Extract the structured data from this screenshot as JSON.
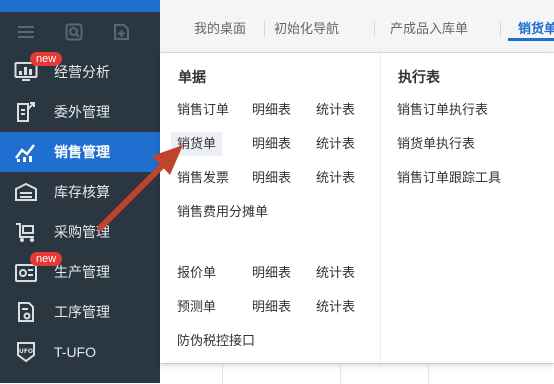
{
  "sidebar": {
    "items": [
      {
        "label": "经营分析",
        "icon": "monitor-chart-icon",
        "badge": "new",
        "active": false
      },
      {
        "label": "委外管理",
        "icon": "clipboard-share-icon",
        "badge": "",
        "active": false
      },
      {
        "label": "销售管理",
        "icon": "line-chart-icon",
        "badge": "",
        "active": true
      },
      {
        "label": "库存核算",
        "icon": "warehouse-icon",
        "badge": "",
        "active": false
      },
      {
        "label": "采购管理",
        "icon": "cart-icon",
        "badge": "",
        "active": false
      },
      {
        "label": "生产管理",
        "icon": "gears-icon",
        "badge": "new",
        "active": false
      },
      {
        "label": "工序管理",
        "icon": "document-gear-icon",
        "badge": "",
        "active": false
      },
      {
        "label": "T-UFO",
        "icon": "ufo-icon",
        "badge": "",
        "active": false
      }
    ]
  },
  "tabs": [
    {
      "label": "我的桌面",
      "active": false
    },
    {
      "label": "初始化导航",
      "active": false
    },
    {
      "label": "产成品入库单",
      "active": false
    },
    {
      "label": "销货单",
      "active": true
    }
  ],
  "menu": {
    "sections": {
      "documents": {
        "title": "单据"
      },
      "reports": {
        "title": "执行表"
      }
    },
    "rows": [
      {
        "name": "销售订单",
        "detail": "明细表",
        "stats": "统计表"
      },
      {
        "name": "销货单",
        "detail": "明细表",
        "stats": "统计表"
      },
      {
        "name": "销售发票",
        "detail": "明细表",
        "stats": "统计表"
      },
      {
        "name": "销售费用分摊单"
      },
      {
        "name": "报价单",
        "detail": "明细表",
        "stats": "统计表"
      },
      {
        "name": "预测单",
        "detail": "明细表",
        "stats": "统计表"
      },
      {
        "name": "防伪税控接口"
      }
    ],
    "report_items": [
      "销售订单执行表",
      "销货单执行表",
      "销售订单跟踪工具"
    ]
  },
  "colors": {
    "accent": "#1f6fd1",
    "sidebar_bg": "#2a3640",
    "badge": "#e53935",
    "arrow": "#c0432e"
  }
}
